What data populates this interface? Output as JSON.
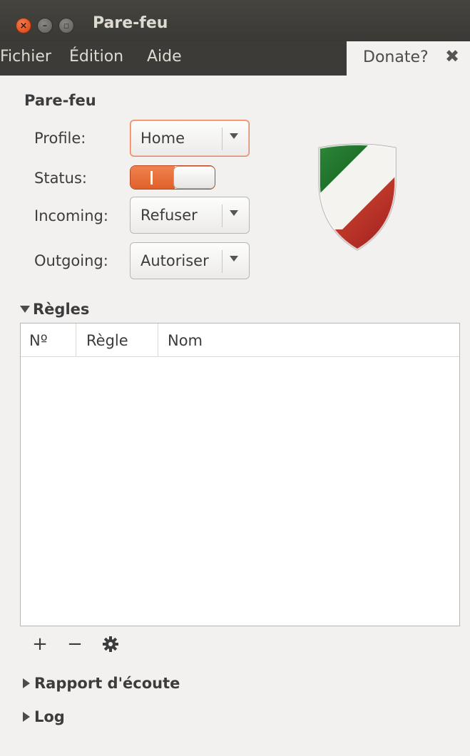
{
  "window": {
    "title": "Pare-feu"
  },
  "menubar": {
    "items": [
      "Fichier",
      "Édition",
      "Aide"
    ]
  },
  "donate": {
    "label": "Donate?"
  },
  "firewall": {
    "section_title": "Pare-feu",
    "profile": {
      "label": "Profile:",
      "value": "Home"
    },
    "status": {
      "label": "Status:",
      "enabled": true
    },
    "incoming": {
      "label": "Incoming:",
      "value": "Refuser"
    },
    "outgoing": {
      "label": "Outgoing:",
      "value": "Autoriser"
    }
  },
  "rules": {
    "title": "Règles",
    "expanded": true,
    "columns": [
      "Nº",
      "Règle",
      "Nom"
    ],
    "rows": []
  },
  "toolbar": {
    "add_icon": "plus-icon",
    "remove_icon": "minus-icon",
    "settings_icon": "gear-icon"
  },
  "listening_report": {
    "title": "Rapport d'écoute",
    "expanded": false
  },
  "log": {
    "title": "Log",
    "expanded": false
  },
  "colors": {
    "accent": "#e9622b",
    "titlebar": "#3c3b37",
    "background": "#f2f1f0"
  }
}
